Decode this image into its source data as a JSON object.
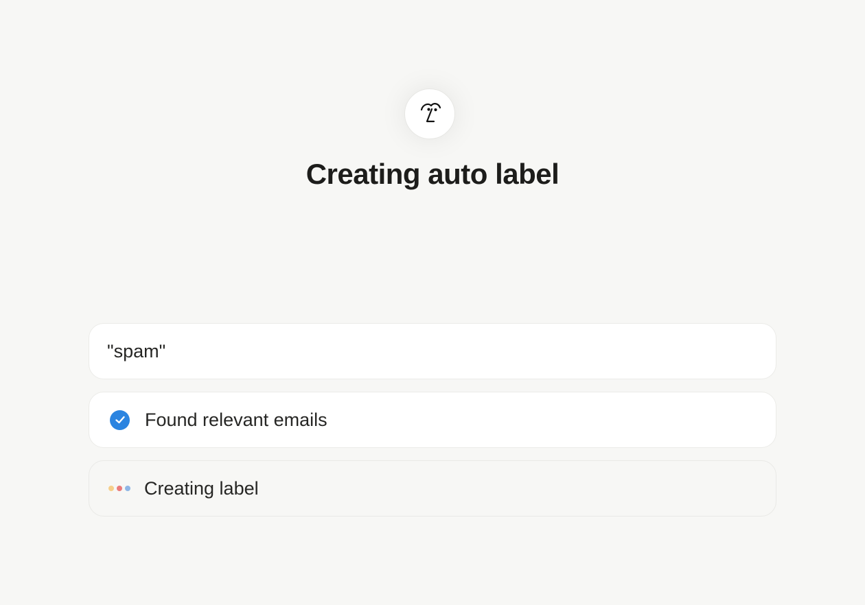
{
  "header": {
    "avatar_icon": "face-logo-icon",
    "title": "Creating auto label"
  },
  "query": {
    "text": "\"spam\""
  },
  "steps": [
    {
      "status": "done",
      "icon": "check-circle-icon",
      "label": "Found relevant emails",
      "color": "#2b84e0"
    },
    {
      "status": "in-progress",
      "icon": "loading-dots-icon",
      "label": "Creating label",
      "dot_colors": [
        "#f6cf8a",
        "#ea7b7b",
        "#8fb6e6"
      ]
    }
  ]
}
